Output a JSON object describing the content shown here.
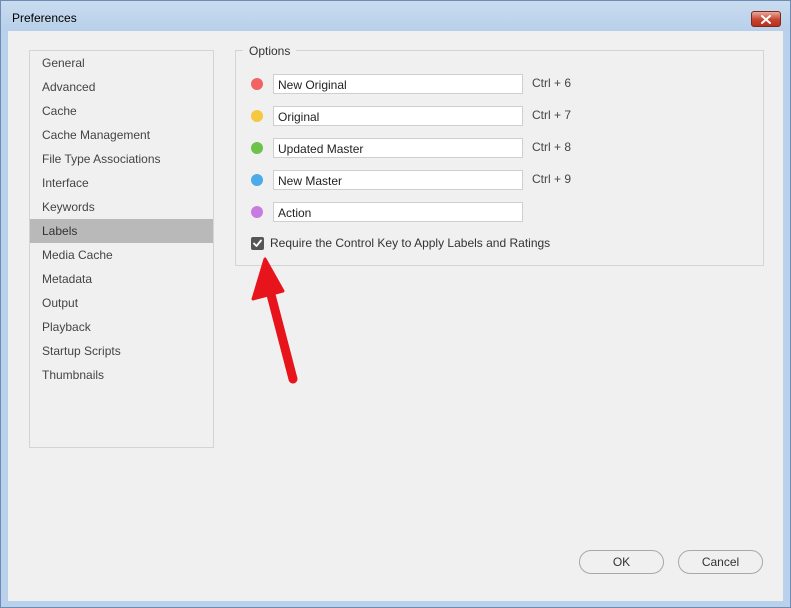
{
  "window": {
    "title": "Preferences"
  },
  "sidebar": {
    "items": [
      {
        "label": "General"
      },
      {
        "label": "Advanced"
      },
      {
        "label": "Cache"
      },
      {
        "label": "Cache Management"
      },
      {
        "label": "File Type Associations"
      },
      {
        "label": "Interface"
      },
      {
        "label": "Keywords"
      },
      {
        "label": "Labels",
        "selected": true
      },
      {
        "label": "Media Cache"
      },
      {
        "label": "Metadata"
      },
      {
        "label": "Output"
      },
      {
        "label": "Playback"
      },
      {
        "label": "Startup Scripts"
      },
      {
        "label": "Thumbnails"
      }
    ]
  },
  "options": {
    "title": "Options",
    "labels": [
      {
        "color": "#f06464",
        "value": "New Original",
        "shortcut": "Ctrl + 6"
      },
      {
        "color": "#f5c842",
        "value": "Original",
        "shortcut": "Ctrl + 7"
      },
      {
        "color": "#6cc24a",
        "value": "Updated Master",
        "shortcut": "Ctrl + 8"
      },
      {
        "color": "#4aabe8",
        "value": "New Master",
        "shortcut": "Ctrl + 9"
      },
      {
        "color": "#c77de0",
        "value": "Action",
        "shortcut": ""
      }
    ],
    "require_control_key": {
      "label": "Require the Control Key to Apply Labels and Ratings",
      "checked": true
    }
  },
  "buttons": {
    "ok": "OK",
    "cancel": "Cancel"
  },
  "annotation": {
    "arrow_color": "#e8141c"
  }
}
